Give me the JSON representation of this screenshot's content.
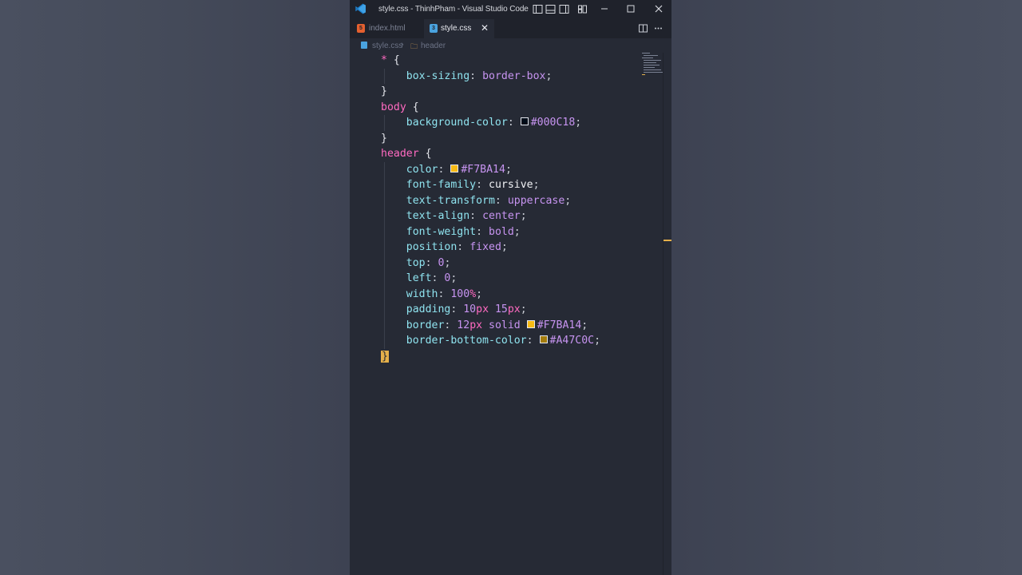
{
  "window": {
    "title": "style.css - ThinhPham - Visual Studio Code"
  },
  "tabs": [
    {
      "label": "index.html",
      "icon": "html5-icon",
      "active": false
    },
    {
      "label": "style.css",
      "icon": "css3-icon",
      "active": true
    }
  ],
  "breadcrumb": {
    "file": "style.css",
    "symbol": "header"
  },
  "code": {
    "selectors": {
      "universal": "*",
      "body": "body",
      "header": "header"
    },
    "open_brace": " {",
    "close_brace": "}",
    "colon": ": ",
    "semicolon": ";",
    "lines": {
      "box_sizing_prop": "box-sizing",
      "box_sizing_val": "border-box",
      "bg_prop": "background-color",
      "bg_val": "#000C18",
      "color_prop": "color",
      "color_val": "#F7BA14",
      "font_family_prop": "font-family",
      "font_family_val": "cursive",
      "text_transform_prop": "text-transform",
      "text_transform_val": "uppercase",
      "text_align_prop": "text-align",
      "text_align_val": "center",
      "font_weight_prop": "font-weight",
      "font_weight_val": "bold",
      "position_prop": "position",
      "position_val": "fixed",
      "top_prop": "top",
      "top_val": "0",
      "left_prop": "left",
      "left_val": "0",
      "width_prop": "width",
      "width_num": "100",
      "width_unit": "%",
      "padding_prop": "padding",
      "padding_num1": "10",
      "padding_num2": "15",
      "px_unit": "px",
      "border_prop": "border",
      "border_num": "12",
      "border_style": "solid",
      "border_color": "#F7BA14",
      "border_bottom_prop": "border-bottom-color",
      "border_bottom_val": "#A47C0C"
    }
  },
  "swatch_colors": {
    "bg": "#000C18",
    "yellow": "#F7BA14",
    "dark_yellow": "#A47C0C"
  },
  "theme": {
    "editor_bg": "#262a35",
    "selector_color": "#ff6ac1",
    "property_color": "#8fe3ef",
    "value_color": "#c794f1",
    "accent": "#e5b04a"
  }
}
